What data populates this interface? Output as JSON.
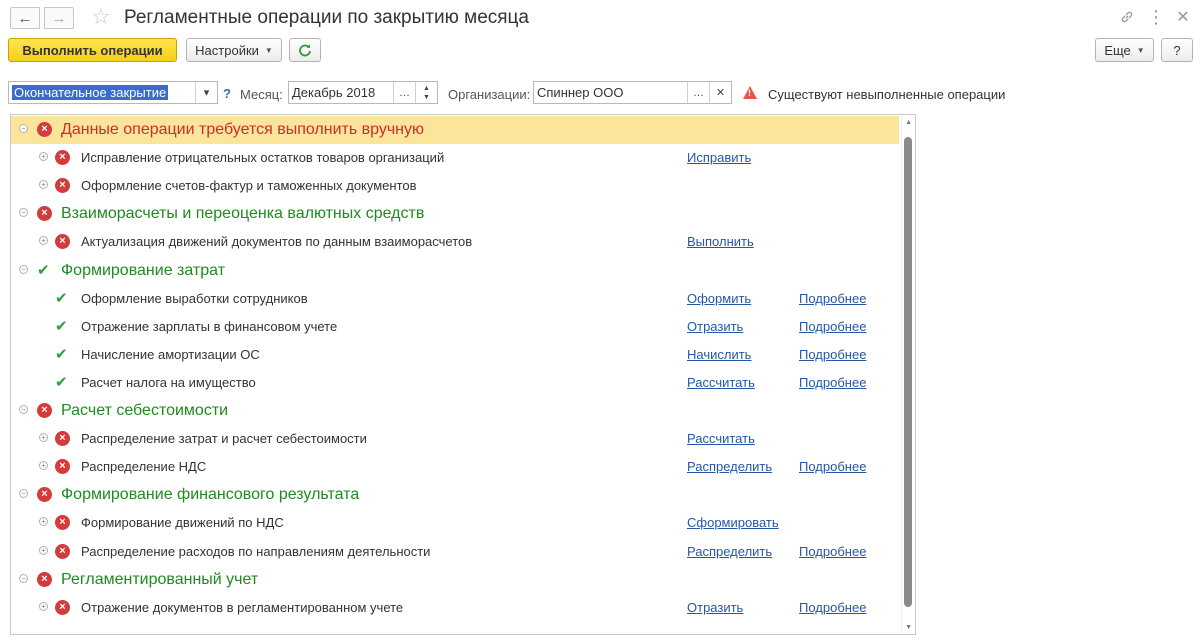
{
  "window": {
    "title": "Регламентные операции по закрытию месяца"
  },
  "toolbar": {
    "execute_label": "Выполнить операции",
    "settings_label": "Настройки",
    "more_label": "Еще",
    "help_label": "?"
  },
  "filters": {
    "mode_value": "Окончательное закрытие",
    "help_mark": "?",
    "month_label": "Месяц:",
    "month_value": "Декабрь 2018",
    "org_label": "Организации:",
    "org_value": "Спиннер ООО",
    "warning_text": "Существуют невыполненные операции"
  },
  "tree": {
    "groups": [
      {
        "title": "Данные операции требуется выполнить вручную",
        "status": "error",
        "title_color": "#d22b2b",
        "items": [
          {
            "label": "Исправление отрицательных остатков товаров организаций",
            "status": "error",
            "action": "Исправить",
            "details": ""
          },
          {
            "label": "Оформление счетов-фактур и таможенных документов",
            "status": "error",
            "action": "",
            "details": ""
          }
        ]
      },
      {
        "title": "Взаиморасчеты и переоценка валютных средств",
        "status": "error",
        "title_color": "#1e8b1e",
        "items": [
          {
            "label": "Актуализация движений документов по данным взаиморасчетов",
            "status": "error",
            "action": "Выполнить",
            "details": ""
          }
        ]
      },
      {
        "title": "Формирование затрат",
        "status": "ok",
        "title_color": "#1e8b1e",
        "items": [
          {
            "label": "Оформление выработки сотрудников",
            "status": "ok",
            "action": "Оформить",
            "details": "Подробнее"
          },
          {
            "label": "Отражение зарплаты в финансовом учете",
            "status": "ok",
            "action": "Отразить",
            "details": "Подробнее"
          },
          {
            "label": "Начисление амортизации ОС",
            "status": "ok",
            "action": "Начислить",
            "details": "Подробнее"
          },
          {
            "label": "Расчет налога на имущество",
            "status": "ok",
            "action": "Рассчитать",
            "details": "Подробнее"
          }
        ]
      },
      {
        "title": "Расчет себестоимости",
        "status": "error",
        "title_color": "#1e8b1e",
        "items": [
          {
            "label": "Распределение затрат и расчет себестоимости",
            "status": "error",
            "action": "Рассчитать",
            "details": ""
          },
          {
            "label": "Распределение НДС",
            "status": "error",
            "action": "Распределить",
            "details": "Подробнее"
          }
        ]
      },
      {
        "title": "Формирование финансового результата",
        "status": "error",
        "title_color": "#1e8b1e",
        "items": [
          {
            "label": "Формирование движений по НДС",
            "status": "error",
            "action": "Сформировать",
            "details": ""
          },
          {
            "label": "Распределение расходов по направлениям деятельности",
            "status": "error",
            "action": "Распределить",
            "details": "Подробнее"
          }
        ]
      },
      {
        "title": "Регламентированный учет",
        "status": "error",
        "title_color": "#1e8b1e",
        "items": [
          {
            "label": "Отражение документов в регламентированном учете",
            "status": "error",
            "action": "Отразить",
            "details": "Подробнее"
          }
        ]
      }
    ]
  }
}
